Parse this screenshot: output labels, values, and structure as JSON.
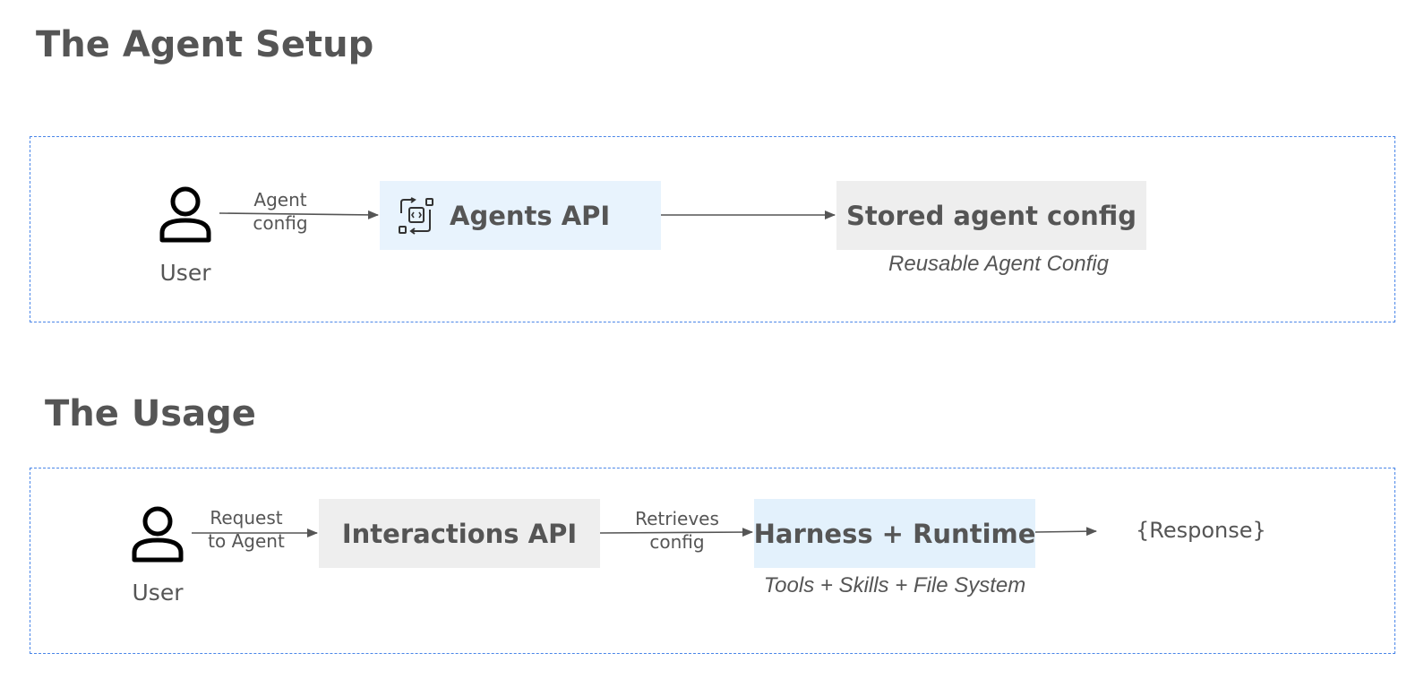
{
  "setup": {
    "title": "The Agent Setup",
    "user_label": "User",
    "edge_label_line1": "Agent",
    "edge_label_line2": "config",
    "agents_api_label": "Agents API",
    "stored_config_label": "Stored agent config",
    "stored_config_caption": "Reusable Agent Config"
  },
  "usage": {
    "title": "The Usage",
    "user_label": "User",
    "request_label_line1": "Request",
    "request_label_line2": "to Agent",
    "interactions_api_label": "Interactions API",
    "retrieves_label_line1": "Retrieves",
    "retrieves_label_line2": "config",
    "harness_label": "Harness + Runtime",
    "harness_caption": "Tools + Skills + File System",
    "response_label": "{Response}"
  },
  "colors": {
    "frame_border": "#4a86e8",
    "blue_box": "#e8f3fd",
    "grey_box": "#eeeeee",
    "text": "#555555",
    "arrow": "#555555"
  },
  "icons": {
    "user": "user-icon",
    "agents_api": "api-code-icon"
  }
}
